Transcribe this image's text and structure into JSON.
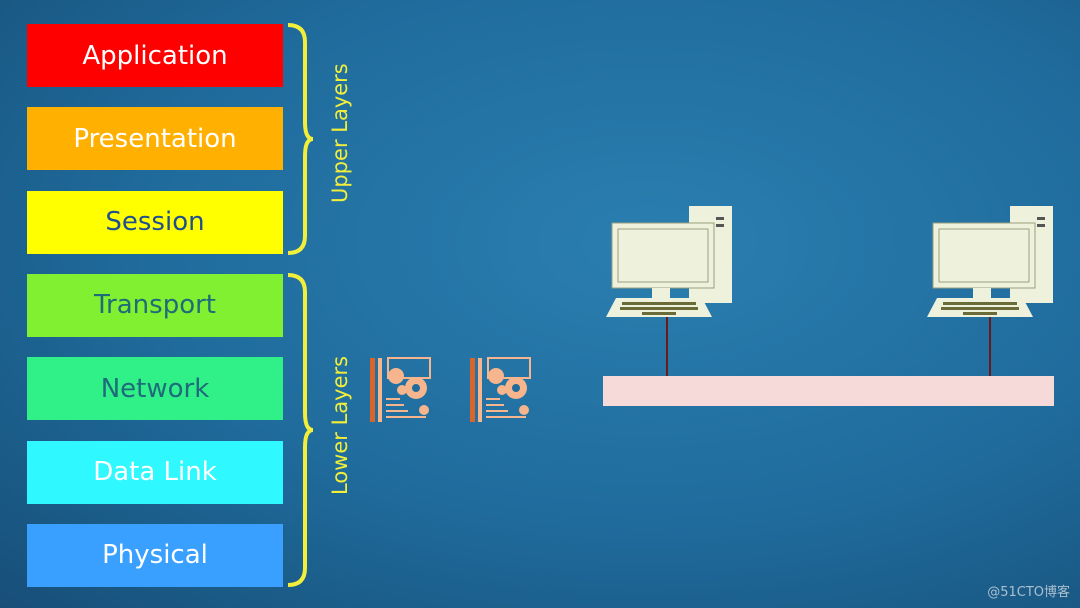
{
  "layers": [
    {
      "label": "Application",
      "bg": "#ff0000",
      "fg": "#ffffff"
    },
    {
      "label": "Presentation",
      "bg": "#ffb000",
      "fg": "#ffffff"
    },
    {
      "label": "Session",
      "bg": "#ffff00",
      "fg": "#1f4f8f"
    },
    {
      "label": "Transport",
      "bg": "#80f030",
      "fg": "#1f6b7a"
    },
    {
      "label": "Network",
      "bg": "#30f088",
      "fg": "#1f6b7a"
    },
    {
      "label": "Data Link",
      "bg": "#30f8ff",
      "fg": "#ffffff"
    },
    {
      "label": "Physical",
      "bg": "#3aa0ff",
      "fg": "#ffffff"
    }
  ],
  "groups": {
    "upper": "Upper Layers",
    "lower": "Lower Layers"
  },
  "colors": {
    "brace": "#f2ee3a",
    "computer": "#eef2dc",
    "cable": "#f6d9d9"
  },
  "icons": [
    "data-packet-gears-icon",
    "desktop-computer-icon"
  ],
  "watermark": "@51CTO博客"
}
